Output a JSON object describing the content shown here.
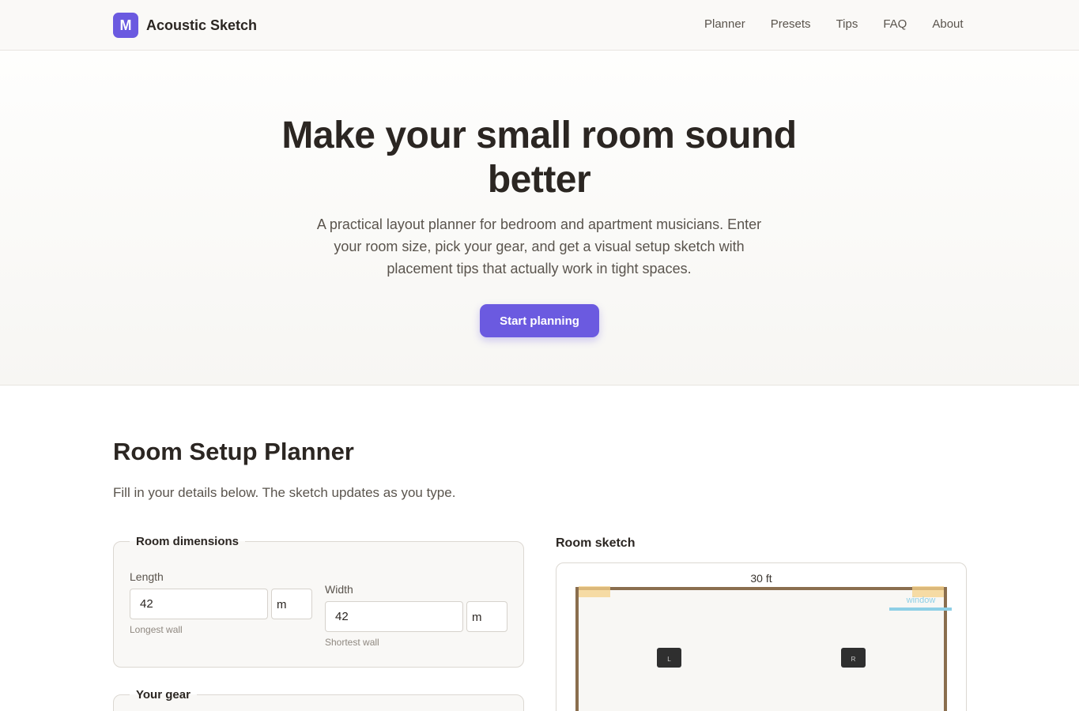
{
  "header": {
    "logo_letter": "M",
    "brand": "Acoustic Sketch",
    "nav": [
      "Planner",
      "Presets",
      "Tips",
      "FAQ",
      "About"
    ]
  },
  "hero": {
    "title": "Make your small room sound better",
    "subtitle": "A practical layout planner for bedroom and apartment musicians. Enter your room size, pick your gear, and get a visual setup sketch with placement tips that actually work in tight spaces.",
    "cta_label": "Start planning"
  },
  "planner": {
    "title": "Room Setup Planner",
    "subtitle": "Fill in your details below. The sketch updates as you type.",
    "dimensions": {
      "legend": "Room dimensions",
      "length_label": "Length",
      "length_value": "42",
      "length_unit": "m",
      "length_hint": "Longest wall",
      "width_label": "Width",
      "width_value": "42",
      "width_unit": "m",
      "width_hint": "Shortest wall"
    },
    "gear": {
      "legend": "Your gear"
    }
  },
  "sketch": {
    "title": "Room sketch",
    "dimension_label": "30 ft",
    "window_label": "window",
    "left_speaker": "L",
    "right_speaker": "R"
  },
  "colors": {
    "accent": "#6b5ae0",
    "wall": "#8a6e4e",
    "window": "#8ecfe6",
    "corner_trap": "#f6d28a",
    "speaker": "#2f2f2f"
  }
}
